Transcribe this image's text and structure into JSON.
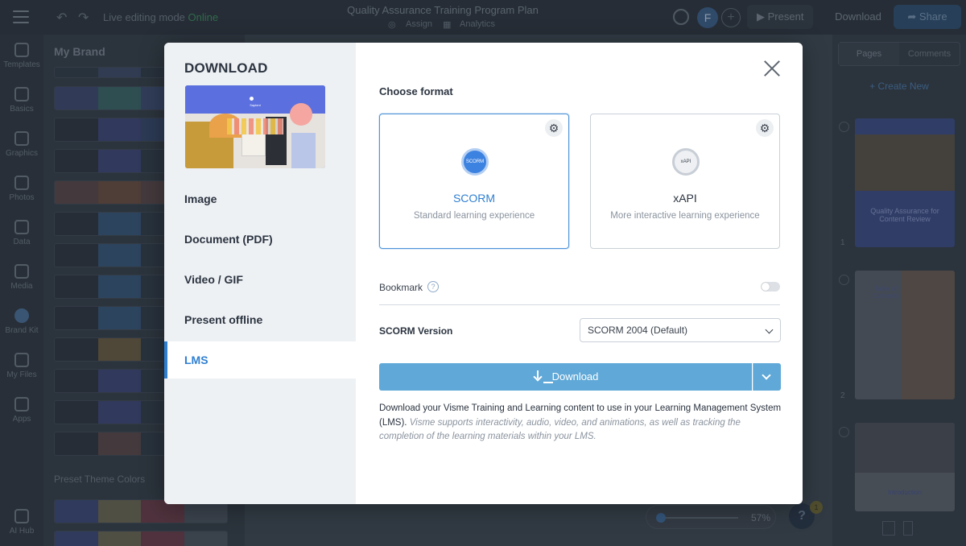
{
  "topbar": {
    "live_prefix": "Live editing mode",
    "live_status": "Online",
    "doc_title": "Quality Assurance Training Program Plan",
    "assign_label": "Assign",
    "analytics_label": "Analytics",
    "avatar_initial": "F",
    "present_label": "Present",
    "download_label": "Download",
    "share_label": "Share"
  },
  "leftnav": {
    "items": [
      {
        "label": "Templates"
      },
      {
        "label": "Basics"
      },
      {
        "label": "Graphics"
      },
      {
        "label": "Photos"
      },
      {
        "label": "Data"
      },
      {
        "label": "Media"
      },
      {
        "label": "Brand Kit"
      },
      {
        "label": "My Files"
      },
      {
        "label": "Apps"
      },
      {
        "label": "AI Hub"
      }
    ]
  },
  "brand_panel": {
    "title": "My Brand",
    "preset_label": "Preset Theme Colors"
  },
  "zoom": {
    "value": "57%"
  },
  "help": {
    "label": "?",
    "badge": "1"
  },
  "right_panel": {
    "tab_pages": "Pages",
    "tab_comments": "Comments",
    "create_new": "+ Create New",
    "pages": [
      {
        "number": "1",
        "heading": "Quality Assurance for Content Review"
      },
      {
        "number": "2",
        "heading": "Table of Contents"
      },
      {
        "number": "",
        "heading": "Introduction"
      }
    ]
  },
  "modal": {
    "title": "DOWNLOAD",
    "preview_brand": "Sapient",
    "menu": [
      {
        "label": "Image"
      },
      {
        "label": "Document (PDF)"
      },
      {
        "label": "Video / GIF"
      },
      {
        "label": "Present offline"
      },
      {
        "label": "LMS"
      }
    ],
    "choose_format": "Choose format",
    "formats": [
      {
        "badge": "SCORM",
        "name": "SCORM",
        "description": "Standard learning experience"
      },
      {
        "badge": "xAPI",
        "name": "xAPI",
        "description": "More interactive learning experience"
      }
    ],
    "bookmark_label": "Bookmark",
    "bookmark_help": "?",
    "version_label": "SCORM Version",
    "version_value": "SCORM 2004 (Default)",
    "download_button": "Download",
    "description_main": "Download your Visme Training and Learning content to use in your Learning Management System (LMS).",
    "description_note": "Visme supports interactivity, audio, video, and animations, as well as tracking the completion of the learning materials within your LMS."
  },
  "colors": {
    "accent": "#2f7fd1",
    "download_button": "#5fa8d7",
    "online": "#3d8f5c"
  }
}
